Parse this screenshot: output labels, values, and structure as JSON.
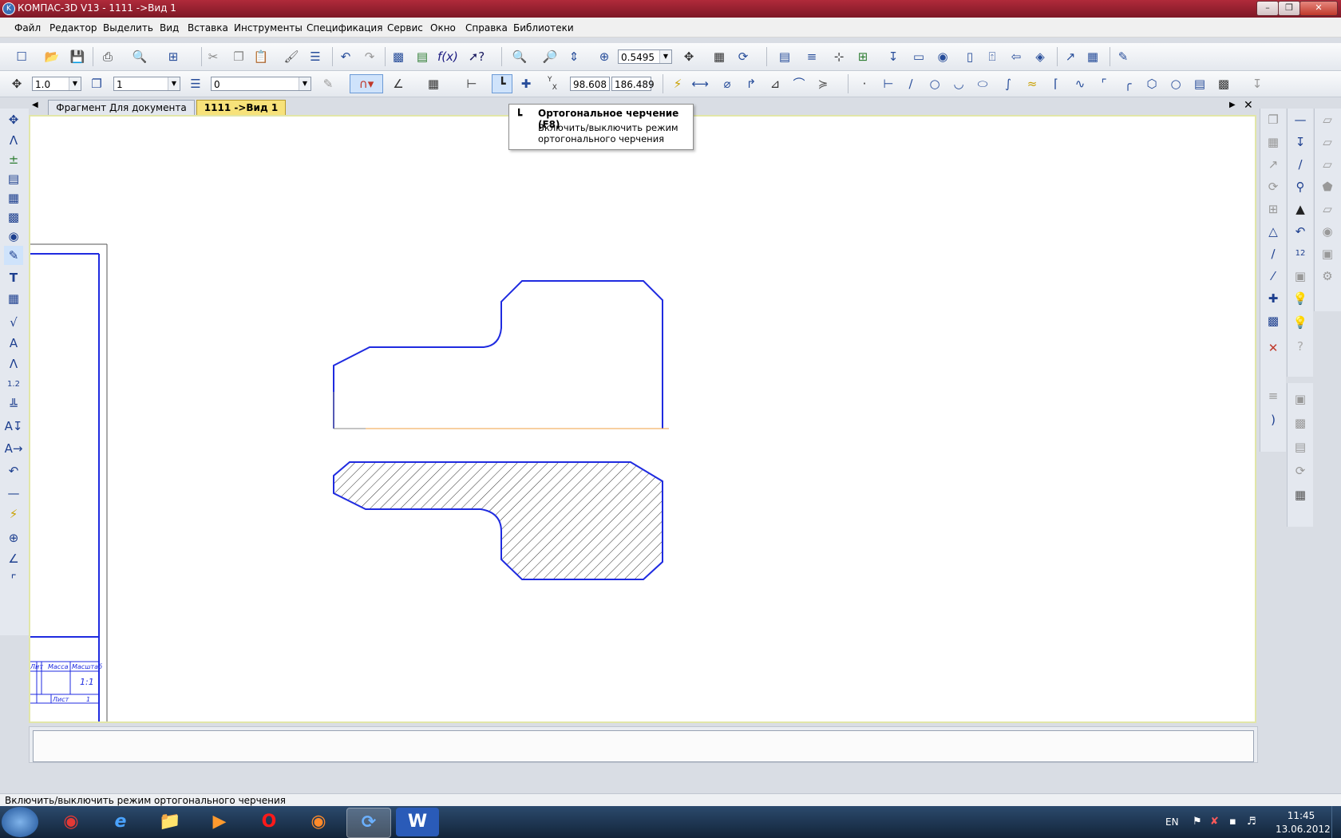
{
  "window": {
    "title": "КОМПАС-3D V13 - 1111 ->Вид 1",
    "icon": "kompas-logo-icon",
    "controls": [
      "minimize",
      "maximize",
      "close"
    ]
  },
  "menu": {
    "items": [
      "Файл",
      "Редактор",
      "Выделить",
      "Вид",
      "Вставка",
      "Инструменты",
      "Спецификация",
      "Сервис",
      "Окно",
      "Справка",
      "Библиотеки"
    ]
  },
  "toolbar1": {
    "zoom_value": "0.5495"
  },
  "toolbar2": {
    "line_width": "1.0",
    "style_value": "1",
    "layer_value": "0",
    "coord_x": "98.608",
    "coord_y": "186.489"
  },
  "tabs": {
    "items": [
      {
        "label": "Фрагмент Для документа",
        "active": false
      },
      {
        "label": "1111 ->Вид 1",
        "active": true
      }
    ]
  },
  "tooltip": {
    "title": "Ортогональное черчение (F8)",
    "description": "Включить/выключить режим ортогонального черчения"
  },
  "drawing": {
    "title_block": {
      "col1": "Лит",
      "col2": "Масса",
      "col3": "Масштаб",
      "scale_value": "1:1",
      "sheet": "Лист",
      "sheet_num": "1"
    },
    "colors": {
      "outline": "#1f2be0",
      "axis": "#f0a040",
      "hatch": "#333333"
    }
  },
  "status": {
    "text": "Включить/выключить режим ортогонального черчения"
  },
  "taskbar": {
    "apps": [
      "chrome",
      "internet-explorer",
      "file-explorer",
      "media-player",
      "opera",
      "firefox",
      "kompas",
      "word"
    ],
    "lang": "EN",
    "time": "11:45",
    "date": "13.06.2012"
  }
}
